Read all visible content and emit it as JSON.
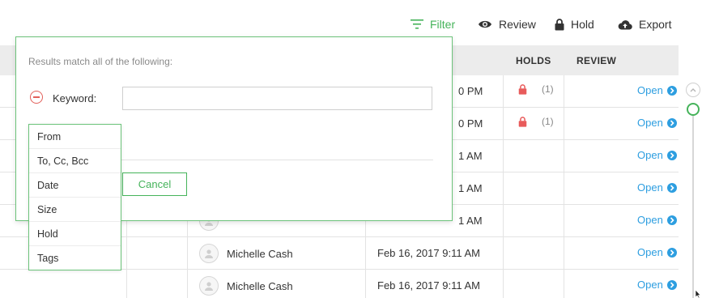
{
  "toolbar": {
    "filter_label": "Filter",
    "review_label": "Review",
    "hold_label": "Hold",
    "export_label": "Export",
    "accent_color": "#45b35a"
  },
  "table": {
    "headers": {
      "holds": "HOLDS",
      "review": "REVIEW"
    },
    "open_label": "Open",
    "rows": [
      {
        "name": "",
        "date": "0 PM",
        "hold_count": "(1)",
        "held": true
      },
      {
        "name": "",
        "date": "0 PM",
        "hold_count": "(1)",
        "held": true
      },
      {
        "name": "",
        "date": "1 AM",
        "hold_count": "",
        "held": false
      },
      {
        "name": "",
        "date": "1 AM",
        "hold_count": "",
        "held": false
      },
      {
        "name": "",
        "date": "1 AM",
        "hold_count": "",
        "held": false
      },
      {
        "name": "Michelle Cash",
        "date": "Feb 16, 2017 9:11 AM",
        "hold_count": "",
        "held": false
      },
      {
        "name": "Michelle Cash",
        "date": "Feb 16, 2017 9:11 AM",
        "hold_count": "",
        "held": false
      }
    ]
  },
  "filter_panel": {
    "title": "Results match all of the following:",
    "keyword_label": "Keyword:",
    "keyword_value": "",
    "cancel_label": "Cancel",
    "field_options": [
      "From",
      "To, Cc, Bcc",
      "Date",
      "Size",
      "Hold",
      "Tags"
    ]
  },
  "icons": {
    "filter": "filter-icon",
    "review": "eye-icon",
    "hold": "lock-icon",
    "export": "cloud-upload-icon",
    "remove": "minus-circle-icon",
    "open": "chevron-right-circle-icon",
    "avatar": "user-icon",
    "scroll_up": "chevron-up-icon"
  },
  "colors": {
    "lock": "#e85b5b",
    "link": "#2d9ee0",
    "remove": "#e2605a"
  }
}
